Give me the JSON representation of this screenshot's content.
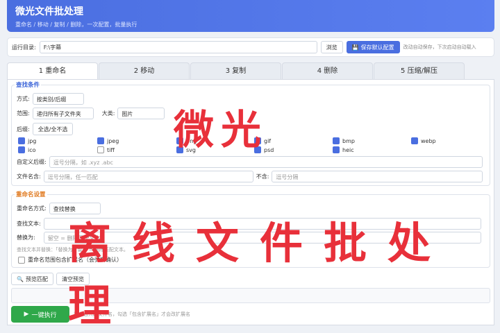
{
  "header": {
    "title": "微光文件批处理",
    "subtitle": "重命名 / 移动 / 复制 / 删除，一次配置，批量执行"
  },
  "pathbar": {
    "label": "运行目录:",
    "path": "F:\\字幕",
    "browse": "浏览",
    "save": "保存默认配置",
    "hint": "改动自动保存，下次启动自动载入"
  },
  "tabs": [
    "1 重命名",
    "2 移动",
    "3 复制",
    "4 删除",
    "5 压缩/解压"
  ],
  "find": {
    "legend": "查找条件",
    "mode_label": "方式:",
    "mode_value": "按类别/后缀",
    "scope_label": "范围:",
    "scope_value": "递归所有子文件夹",
    "category_label": "大类:",
    "category_value": "图片",
    "suffix_label": "后缀:",
    "suffix_toggle": "全选/全不选",
    "exts": [
      {
        "name": "jpg",
        "checked": true
      },
      {
        "name": "jpeg",
        "checked": true
      },
      {
        "name": "png",
        "checked": true
      },
      {
        "name": "gif",
        "checked": true
      },
      {
        "name": "bmp",
        "checked": true
      },
      {
        "name": "webp",
        "checked": true
      },
      {
        "name": "ico",
        "checked": true
      },
      {
        "name": "tiff",
        "checked": false
      },
      {
        "name": "svg",
        "checked": true
      },
      {
        "name": "psd",
        "checked": true
      },
      {
        "name": "heic",
        "checked": true
      }
    ],
    "custom_label": "自定义后缀:",
    "custom_placeholder": "逗号分隔，如 .xyz .abc",
    "contains_label": "文件名含:",
    "contains_placeholder": "逗号分隔，任一匹配",
    "exclude_label": "不含:",
    "exclude_placeholder": "逗号分隔"
  },
  "rename": {
    "legend": "重命名设置",
    "mode_label": "重命名方式:",
    "mode_value": "查找替换",
    "find_label": "查找文本:",
    "replace_label": "替换为:",
    "replace_placeholder": "留空 = 删除匹配文本",
    "note": "查找文本并替换：「替换为」留空 = 删除匹配文本。",
    "include_ext": "重命名范围包含扩展名（会弹窗确认）"
  },
  "actions": {
    "preview": "预览匹配",
    "clear": "清空预览",
    "run": "一键执行",
    "run_note": "重命名只改文件名，勾选「包含扩展名」才会改扩展名"
  },
  "watermark": {
    "line1": "微光",
    "line2": "离线文件批处理"
  }
}
